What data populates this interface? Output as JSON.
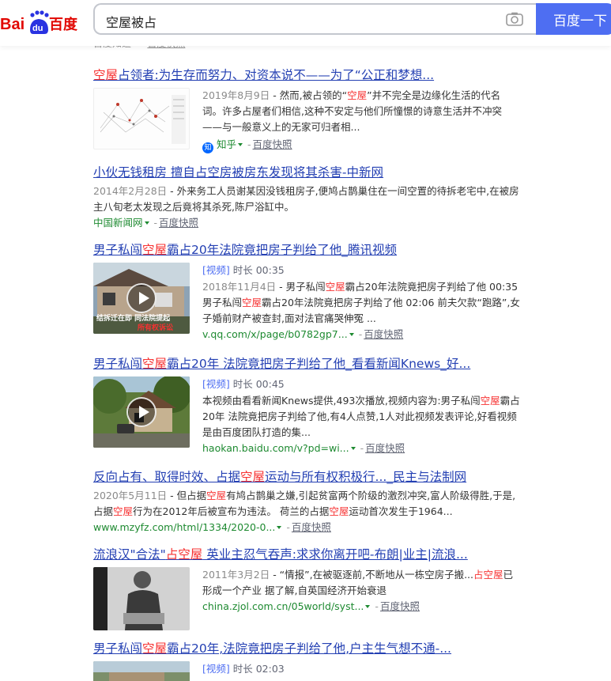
{
  "header": {
    "logo_text": "Bai百度",
    "query": "空屋被占",
    "search_button": "百度一下"
  },
  "cut_row": {
    "source": "百度知道",
    "kuaizhao": "百度快照"
  },
  "results": [
    {
      "title_pre": "",
      "title_hl": "空屋",
      "title_post": "占领者:为生存而努力、对资本说不——为了“公正和梦想...",
      "date": "2019年8月9日",
      "abs_pre": " - 然而,被占领的“",
      "abs_hl": "空屋",
      "abs_post": "”并不完全是边缘化生活的代名词。许多占屋者们相信,这种不安定与他们所憧憬的诗意生活并不冲突——与一般意义上的无家可归者相...",
      "source": "知乎",
      "kuaizhao": "百度快照"
    },
    {
      "title": "小伙无钱租房 擅自占空房被房东发现将其杀害-中新网",
      "date": "2014年2月28日",
      "abstract": " - 外来务工人员谢某因没钱租房子,便鸠占鹊巢住在一间空置的待拆老宅中,在被房主八旬老太发现之后竟将其杀死,陈尸浴缸中。",
      "source": "中国新闻网",
      "kuaizhao": "百度快照"
    },
    {
      "title_pre": "男子私闯",
      "title_hl": "空屋",
      "title_post": "霸占20年法院竟把房子判给了他_腾讯视频",
      "video_tag": "[视频]",
      "duration": "时长 00:35",
      "date": "2018年11月4日",
      "abs_pre": " - 男子私闯",
      "abs_hl": "空屋",
      "abs_mid": "霸占20年法院竟把房子判给了他 00:35 男子私闯",
      "abs_hl2": "空屋",
      "abs_post": "霸占20年法院竟把房子判给了他 02:06 前夫欠款“跑路”,女子婚前财产被查封,面对法官痛哭伸冤 ...",
      "thumb_caption": "结拆迁在即 同法院提起",
      "thumb_caption_hl": "所有权诉讼",
      "source": "v.qq.com/x/page/b0782gp7...",
      "kuaizhao": "百度快照"
    },
    {
      "title_pre": "男子私闯",
      "title_hl": "空屋",
      "title_post": "霸占20年 法院竟把房子判给了他_看看新闻Knews_好...",
      "video_tag": "[视频]",
      "duration": "时长 00:45",
      "abs_pre": "本视频由看看新闻Knews提供,493次播放,视频内容为:男子私闯",
      "abs_hl": "空屋",
      "abs_post": "霸占20年 法院竟把房子判给了他,有4人点赞,1人对此视频发表评论,好看视频是由百度团队打造的集...",
      "source": "haokan.baidu.com/v?pd=wi...",
      "kuaizhao": "百度快照"
    },
    {
      "title_pre": "反向占有、取得时效、占据",
      "title_hl": "空屋",
      "title_post": "运动与所有权积极行..._民主与法制网",
      "date": "2020年5月11日",
      "abs_pre": " - 但占据",
      "abs_hl": "空屋",
      "abs_mid": "有鸠占鹊巢之嫌,引起贫富两个阶级的激烈冲突,富人阶级得胜,于是,占据",
      "abs_hl2": "空屋",
      "abs_mid2": "行为在2012年后被宣布为违法。 荷兰的占据",
      "abs_hl3": "空屋",
      "abs_post": "运动首次发生于1964...",
      "source": "www.mzyfz.com/html/1334/2020-0...",
      "kuaizhao": "百度快照"
    },
    {
      "title_pre": "流浪汉\"合法\"",
      "title_hl": "占空屋",
      "title_post": " 英业主忍气吞声:求求你离开吧-布朗|业主|流浪...",
      "date": "2011年3月2日",
      "abs_pre": " - “情报”,在被驱逐前,不断地从一栋空房子搬...",
      "abs_hl": "占空屋",
      "abs_post": "已形成一个产业 据了解,自英国经济开始衰退",
      "source": "china.zjol.com.cn/05world/syst...",
      "kuaizhao": "百度快照"
    },
    {
      "title_pre": "男子私闯",
      "title_hl": "空屋",
      "title_post": "霸占20年,法院竟把房子判给了他,户主生气想不通-...",
      "video_tag": "[视频]",
      "duration": "时长 02:03"
    }
  ]
}
